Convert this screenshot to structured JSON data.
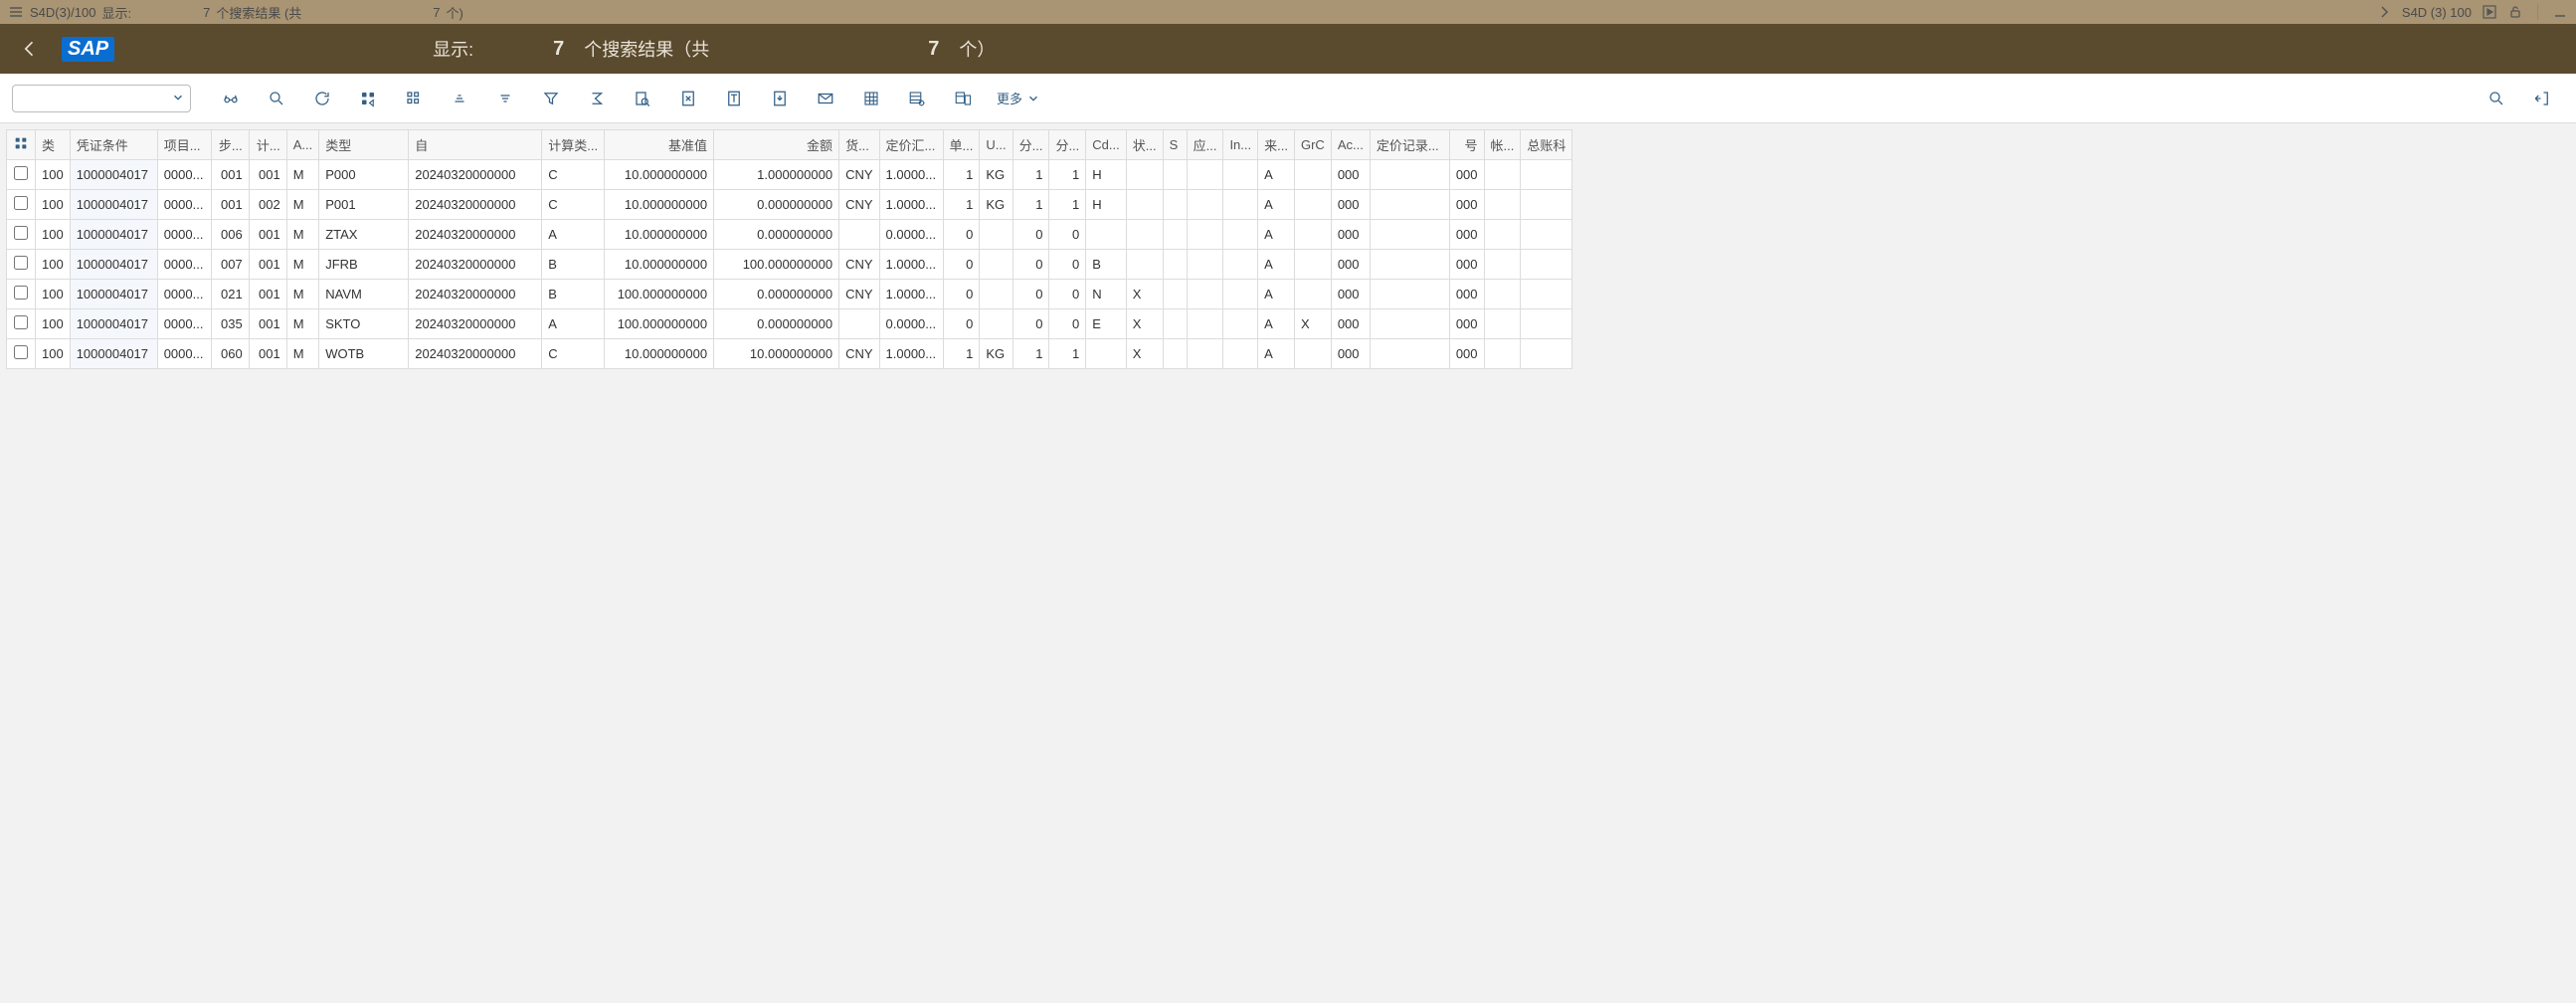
{
  "sysbar": {
    "left_session": "S4D(3)/100",
    "left_label": "显示:",
    "left_count": "7",
    "left_text1": "个搜索结果 (共",
    "left_total": "7",
    "left_text2": "个)",
    "right_session": "S4D (3) 100"
  },
  "header": {
    "logo": "SAP",
    "title_label": "显示:",
    "count": "7",
    "mid": "个搜索结果（共",
    "total": "7",
    "tail": "个）"
  },
  "toolbar": {
    "cmd_value": "",
    "more_label": "更多"
  },
  "columns": [
    {
      "key": "sel",
      "label": "",
      "w": 28,
      "align": "ctr"
    },
    {
      "key": "cls",
      "label": "类",
      "w": 34
    },
    {
      "key": "doc",
      "label": "凭证条件",
      "w": 88
    },
    {
      "key": "item",
      "label": "项目...",
      "w": 54
    },
    {
      "key": "step",
      "label": "步...",
      "w": 38,
      "align": "num"
    },
    {
      "key": "cnt",
      "label": "计...",
      "w": 38,
      "align": "num"
    },
    {
      "key": "a",
      "label": "A...",
      "w": 24
    },
    {
      "key": "type",
      "label": "类型",
      "w": 90
    },
    {
      "key": "from",
      "label": "自",
      "w": 134
    },
    {
      "key": "calc",
      "label": "计算类...",
      "w": 62
    },
    {
      "key": "base",
      "label": "基准值",
      "w": 110,
      "align": "num"
    },
    {
      "key": "amt",
      "label": "金额",
      "w": 126,
      "align": "num"
    },
    {
      "key": "cur",
      "label": "货...",
      "w": 34
    },
    {
      "key": "rate",
      "label": "定价汇...",
      "w": 64
    },
    {
      "key": "unit",
      "label": "单...",
      "w": 30,
      "align": "num"
    },
    {
      "key": "uom",
      "label": "U...",
      "w": 30
    },
    {
      "key": "n1",
      "label": "分...",
      "w": 30,
      "align": "num"
    },
    {
      "key": "n2",
      "label": "分...",
      "w": 30,
      "align": "num"
    },
    {
      "key": "cd",
      "label": "Cd...",
      "w": 36
    },
    {
      "key": "st",
      "label": "状...",
      "w": 32
    },
    {
      "key": "s",
      "label": "S",
      "w": 24
    },
    {
      "key": "app",
      "label": "应...",
      "w": 30
    },
    {
      "key": "in",
      "label": "In...",
      "w": 30
    },
    {
      "key": "src",
      "label": "来...",
      "w": 30
    },
    {
      "key": "grc",
      "label": "GrC",
      "w": 34
    },
    {
      "key": "ac",
      "label": "Ac...",
      "w": 36
    },
    {
      "key": "rec",
      "label": "定价记录...",
      "w": 80
    },
    {
      "key": "no",
      "label": "号",
      "w": 34,
      "align": "num"
    },
    {
      "key": "acct",
      "label": "帐...",
      "w": 30
    },
    {
      "key": "gl",
      "label": "总账科",
      "w": 50
    }
  ],
  "rows": [
    {
      "cls": "100",
      "doc": "1000004017",
      "item": "0000...",
      "step": "001",
      "cnt": "001",
      "a": "M",
      "type": "P000",
      "from": "20240320000000",
      "calc": "C",
      "base": "10.000000000",
      "amt": "1.000000000",
      "cur": "CNY",
      "rate": "1.0000...",
      "unit": "1",
      "uom": "KG",
      "n1": "1",
      "n2": "1",
      "cd": "H",
      "st": "",
      "s": "",
      "app": "",
      "in": "",
      "src": "A",
      "grc": "",
      "ac": "000",
      "rec": "",
      "no": "000",
      "acct": "",
      "gl": ""
    },
    {
      "cls": "100",
      "doc": "1000004017",
      "item": "0000...",
      "step": "001",
      "cnt": "002",
      "a": "M",
      "type": "P001",
      "from": "20240320000000",
      "calc": "C",
      "base": "10.000000000",
      "amt": "0.000000000",
      "cur": "CNY",
      "rate": "1.0000...",
      "unit": "1",
      "uom": "KG",
      "n1": "1",
      "n2": "1",
      "cd": "H",
      "st": "",
      "s": "",
      "app": "",
      "in": "",
      "src": "A",
      "grc": "",
      "ac": "000",
      "rec": "",
      "no": "000",
      "acct": "",
      "gl": ""
    },
    {
      "cls": "100",
      "doc": "1000004017",
      "item": "0000...",
      "step": "006",
      "cnt": "001",
      "a": "M",
      "type": "ZTAX",
      "from": "20240320000000",
      "calc": "A",
      "base": "10.000000000",
      "amt": "0.000000000",
      "cur": "",
      "rate": "0.0000...",
      "unit": "0",
      "uom": "",
      "n1": "0",
      "n2": "0",
      "cd": "",
      "st": "",
      "s": "",
      "app": "",
      "in": "",
      "src": "A",
      "grc": "",
      "ac": "000",
      "rec": "",
      "no": "000",
      "acct": "",
      "gl": ""
    },
    {
      "cls": "100",
      "doc": "1000004017",
      "item": "0000...",
      "step": "007",
      "cnt": "001",
      "a": "M",
      "type": "JFRB",
      "from": "20240320000000",
      "calc": "B",
      "base": "10.000000000",
      "amt": "100.000000000",
      "cur": "CNY",
      "rate": "1.0000...",
      "unit": "0",
      "uom": "",
      "n1": "0",
      "n2": "0",
      "cd": "B",
      "st": "",
      "s": "",
      "app": "",
      "in": "",
      "src": "A",
      "grc": "",
      "ac": "000",
      "rec": "",
      "no": "000",
      "acct": "",
      "gl": ""
    },
    {
      "cls": "100",
      "doc": "1000004017",
      "item": "0000...",
      "step": "021",
      "cnt": "001",
      "a": "M",
      "type": "NAVM",
      "from": "20240320000000",
      "calc": "B",
      "base": "100.000000000",
      "amt": "0.000000000",
      "cur": "CNY",
      "rate": "1.0000...",
      "unit": "0",
      "uom": "",
      "n1": "0",
      "n2": "0",
      "cd": "N",
      "st": "X",
      "s": "",
      "app": "",
      "in": "",
      "src": "A",
      "grc": "",
      "ac": "000",
      "rec": "",
      "no": "000",
      "acct": "",
      "gl": ""
    },
    {
      "cls": "100",
      "doc": "1000004017",
      "item": "0000...",
      "step": "035",
      "cnt": "001",
      "a": "M",
      "type": "SKTO",
      "from": "20240320000000",
      "calc": "A",
      "base": "100.000000000",
      "amt": "0.000000000",
      "cur": "",
      "rate": "0.0000...",
      "unit": "0",
      "uom": "",
      "n1": "0",
      "n2": "0",
      "cd": "E",
      "st": "X",
      "s": "",
      "app": "",
      "in": "",
      "src": "A",
      "grc": "X",
      "ac": "000",
      "rec": "",
      "no": "000",
      "acct": "",
      "gl": ""
    },
    {
      "cls": "100",
      "doc": "1000004017",
      "item": "0000...",
      "step": "060",
      "cnt": "001",
      "a": "M",
      "type": "WOTB",
      "from": "20240320000000",
      "calc": "C",
      "base": "10.000000000",
      "amt": "10.000000000",
      "cur": "CNY",
      "rate": "1.0000...",
      "unit": "1",
      "uom": "KG",
      "n1": "1",
      "n2": "1",
      "cd": "",
      "st": "X",
      "s": "",
      "app": "",
      "in": "",
      "src": "A",
      "grc": "",
      "ac": "000",
      "rec": "",
      "no": "000",
      "acct": "",
      "gl": ""
    }
  ]
}
